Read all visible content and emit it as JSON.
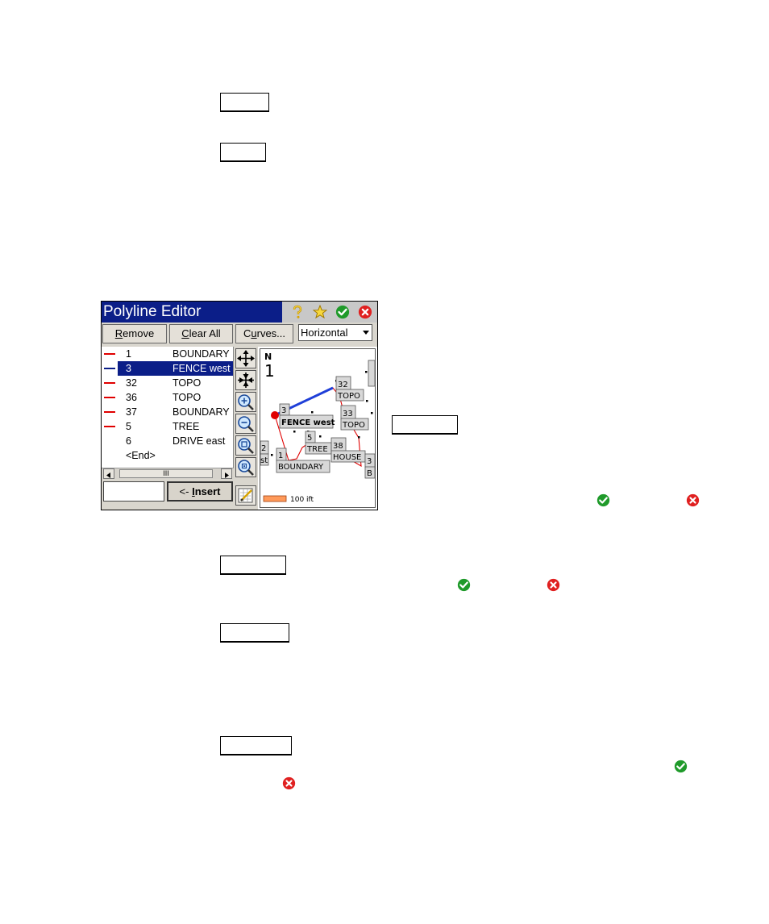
{
  "window": {
    "title": "Polyline Editor",
    "icons": [
      "help-icon",
      "star-icon",
      "ok-icon",
      "close-icon"
    ]
  },
  "toolbar": {
    "remove_label": "Remove",
    "remove_mnemonic": "R",
    "remove_rest": "emove",
    "clear_all_mnemonic": "C",
    "clear_all_rest": "lear All",
    "curves_mnemonic": "u",
    "curves_pre": "C",
    "curves_rest": "rves...",
    "dropdown_value": "Horizontal"
  },
  "list": {
    "rows": [
      {
        "num": "1",
        "desc": "BOUNDARY",
        "marked": true,
        "selected": false
      },
      {
        "num": "3",
        "desc": "FENCE west",
        "marked": true,
        "selected": true
      },
      {
        "num": "32",
        "desc": "TOPO",
        "marked": true,
        "selected": false
      },
      {
        "num": "36",
        "desc": "TOPO",
        "marked": true,
        "selected": false
      },
      {
        "num": "37",
        "desc": "BOUNDARY",
        "marked": true,
        "selected": false
      },
      {
        "num": "5",
        "desc": "TREE",
        "marked": true,
        "selected": false
      },
      {
        "num": "6",
        "desc": "DRIVE east",
        "marked": false,
        "selected": false
      },
      {
        "num": "<End>",
        "desc": "",
        "marked": false,
        "selected": false
      }
    ],
    "scroll_thumb": "III"
  },
  "bottom": {
    "insert_pre": "<- ",
    "insert_mnemonic": "I",
    "insert_rest": "nsert",
    "input_value": ""
  },
  "tools": [
    "pan-icon",
    "zoom-extents-icon",
    "zoom-in-icon",
    "zoom-out-icon",
    "zoom-window-icon",
    "zoom-previous-icon",
    "edit-icon"
  ],
  "map": {
    "north_label": "N",
    "north_value": "1",
    "scale_label": "100 ift",
    "labels": {
      "fence": "FENCE west",
      "topo1": "TOPO",
      "topo2": "TOPO",
      "boundary": "BOUNDARY",
      "tree": "TREE",
      "house": "HOUSE",
      "n32": "32",
      "n33": "33",
      "n38": "38",
      "n5": "5",
      "n1": "1",
      "n2": "2",
      "n3": "3",
      "nb": "B",
      "st": "st",
      "nsel": "3"
    }
  },
  "colors": {
    "titlebar": "#0b1e88",
    "polyline": "#e00000",
    "selected_segment": "#1f3fd8",
    "ok_green": "#1f9a2a",
    "cancel_red": "#e02020"
  }
}
